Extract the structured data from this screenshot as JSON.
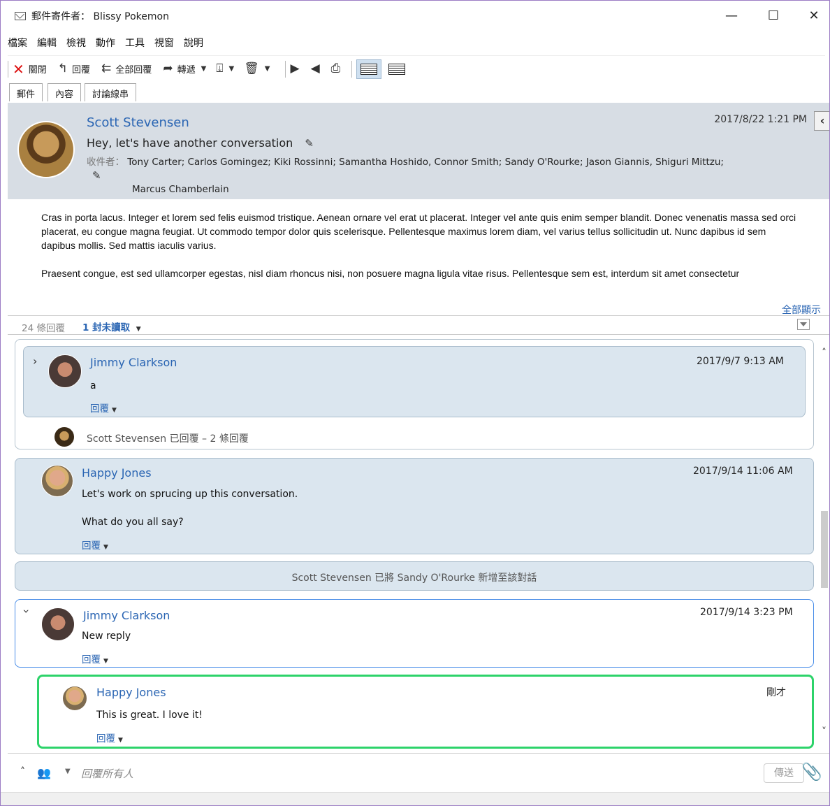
{
  "window": {
    "title": "郵件寄件者： Blissy Pokemon",
    "minimize": "—",
    "maximize": "☐",
    "close": "✕"
  },
  "menu": [
    "檔案",
    "編輯",
    "檢視",
    "動作",
    "工具",
    "視窗",
    "說明"
  ],
  "toolbar": {
    "close": "關閉",
    "reply": "回覆",
    "reply_all": "全部回覆",
    "forward": "轉遞"
  },
  "tabs": [
    "郵件",
    "內容",
    "討論線串"
  ],
  "header": {
    "sender": "Scott Stevensen",
    "subject": "Hey, let's have another conversation",
    "date": "2017/8/22 1:21 PM",
    "to_label": "收件者：",
    "to_line1": "Tony Carter; Carlos Gomingez; Kiki Rossinni; Samantha Hoshido, Connor Smith; Sandy O'Rourke; Jason Giannis, Shiguri Mittzu;",
    "to_line2": "Marcus Chamberlain"
  },
  "body": {
    "p1": "Cras in porta lacus. Integer et lorem sed felis euismod tristique. Aenean ornare vel erat ut placerat. Integer vel ante quis enim semper blandit. Donec venenatis massa sed orci placerat, eu congue magna feugiat. Ut commodo tempor dolor quis scelerisque. Pellentesque maximus lorem diam, vel varius tellus sollicitudin ut. Nunc dapibus id sem dapibus mollis. Sed mattis iaculis varius.",
    "p2": "Praesent congue, est sed ullamcorper egestas, nisl diam rhoncus nisi, non posuere magna ligula vitae risus. Pellentesque sem est, interdum sit amet consectetur"
  },
  "show_all": "全部顯示",
  "replies_bar": {
    "count": "24 條回覆",
    "unread": "1 封未讀取"
  },
  "thread": {
    "m1": {
      "name": "Jimmy Clarkson",
      "date": "2017/9/7 9:13 AM",
      "text": "a",
      "reply": "回覆"
    },
    "m1_summary": "Scott Stevensen 已回覆 – 2 條回覆",
    "m2": {
      "name": "Happy Jones",
      "date": "2017/9/14 11:06 AM",
      "line1": "Let's work on sprucing up this conversation.",
      "line2": "What do you all say?",
      "reply": "回覆"
    },
    "system": "Scott Stevensen 已將 Sandy O'Rourke 新增至該對話",
    "m3": {
      "name": "Jimmy Clarkson",
      "date": "2017/9/14 3:23 PM",
      "text": "New reply",
      "reply": "回覆"
    },
    "m4": {
      "name": "Happy Jones",
      "date": "剛才",
      "text": "This is great. I love it!",
      "reply": "回覆"
    }
  },
  "compose": {
    "placeholder": "回覆所有人",
    "send": "傳送"
  },
  "icons": {
    "close": "close-icon",
    "reply": "reply-icon",
    "reply_all": "reply-all-icon",
    "forward": "forward-icon",
    "move": "move-to-folder-icon",
    "delete": "trash-icon",
    "next": "next-icon",
    "previous": "previous-icon",
    "print": "print-icon",
    "edit": "pencil-icon",
    "attach": "paperclip-icon",
    "people": "people-icon"
  },
  "colors": {
    "link": "#2a65b3",
    "header_bg": "#d7dde4",
    "card_bg": "#dbe6ef",
    "selected_border": "#4a8ee8",
    "new_border": "#2dd36a",
    "close_red": "#dd1111"
  }
}
